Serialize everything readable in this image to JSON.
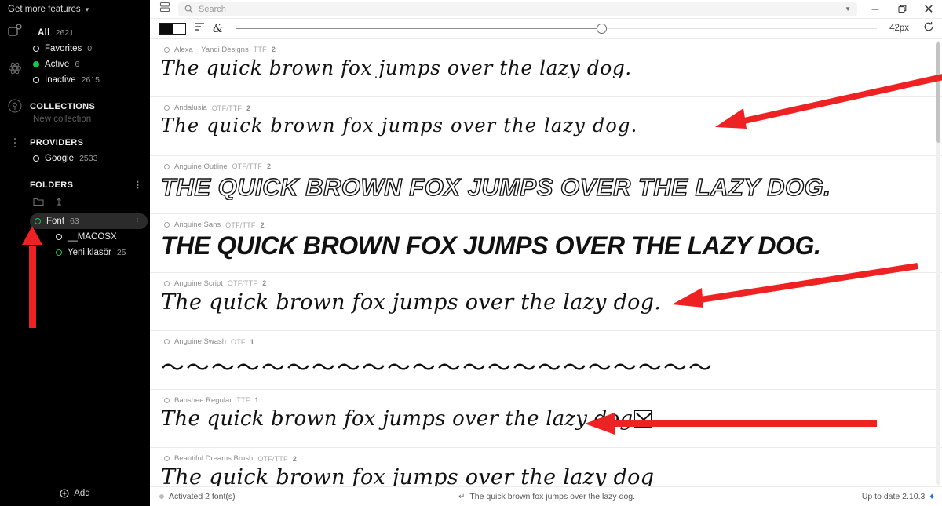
{
  "sidebar": {
    "header": {
      "label": "Get more features",
      "chevron": "chevron-down-icon"
    },
    "rail_icons": [
      "fonts-icon",
      "settings-atom-icon",
      "broadcast-icon",
      "more-vertical-icon"
    ],
    "filters": [
      {
        "label": "All",
        "count": "2621",
        "state": "none"
      },
      {
        "label": "Favorites",
        "count": "0",
        "state": "ring"
      },
      {
        "label": "Active",
        "count": "6",
        "state": "green"
      },
      {
        "label": "Inactive",
        "count": "2615",
        "state": "ring"
      }
    ],
    "collections": {
      "title": "COLLECTIONS",
      "new_label": "New collection"
    },
    "providers": {
      "title": "PROVIDERS",
      "items": [
        {
          "label": "Google",
          "count": "2533",
          "state": "ring"
        }
      ]
    },
    "folders": {
      "title": "FOLDERS",
      "kebab": "more-options-icon",
      "actions": [
        "new-folder-icon",
        "import-folder-icon"
      ],
      "items": [
        {
          "label": "Font",
          "count": "63",
          "state": "hollow-green",
          "selected": true,
          "kebab": "more-options-icon"
        },
        {
          "label": "__MACOSX",
          "count": "",
          "state": "ring",
          "selected": false
        },
        {
          "label": "Yeni klasör",
          "count": "25",
          "state": "hollow-green",
          "selected": false
        }
      ]
    },
    "add_button": {
      "label": "Add",
      "icon": "plus-circle-icon"
    }
  },
  "titlebar": {
    "panel_toggle_icon": "panel-layout-icon",
    "search": {
      "placeholder": "Search",
      "value": "",
      "icon": "search-icon",
      "caret": "chevron-down-icon"
    },
    "window_controls": [
      {
        "name": "minimize-button",
        "glyph": "–"
      },
      {
        "name": "maximize-button",
        "glyph": "❐"
      },
      {
        "name": "close-button",
        "glyph": "✕"
      }
    ]
  },
  "toolbar": {
    "contrast_toggle": "black-white-contrast-toggle",
    "align_icon": "text-align-left-icon",
    "glyph_icon": "ampersand-glyph-icon",
    "slider": {
      "value_percent": 57
    },
    "size_label": "42px",
    "reset_icon": "reset-rotate-icon"
  },
  "fonts": [
    {
      "name": "Alexa _ Yandi Designs",
      "format": "TTF",
      "styles": "2",
      "preview": "The quick brown fox jumps over the lazy dog.",
      "style_class": "p-script"
    },
    {
      "name": "Andalusia",
      "format": "OTF/TTF",
      "styles": "2",
      "preview": "The quick brown fox jumps over the lazy dog.",
      "style_class": "p-thin-script"
    },
    {
      "name": "Anguine Outline",
      "format": "OTF/TTF",
      "styles": "2",
      "preview": "THE QUICK BROWN FOX JUMPS OVER THE LAZY  DOG.",
      "style_class": "p-outline"
    },
    {
      "name": "Anguine Sans",
      "format": "OTF/TTF",
      "styles": "2",
      "preview": "THE QUICK BROWN FOX JUMPS OVER THE LAZY DOG.",
      "style_class": "p-sans-black"
    },
    {
      "name": "Anguine Script",
      "format": "OTF/TTF",
      "styles": "2",
      "preview": "The quick brown fox jumps over the lazy dog.",
      "style_class": "p-brush"
    },
    {
      "name": "Anguine Swash",
      "format": "OTF",
      "styles": "1",
      "preview": "〜〜〜〜〜〜〜〜〜〜〜〜〜〜〜〜〜〜〜〜〜〜",
      "style_class": "p-swash"
    },
    {
      "name": "Banshee Regular",
      "format": "TTF",
      "styles": "1",
      "preview": "The quick brown fox jumps over the lazy dog",
      "style_class": "p-handwrite",
      "missing_glyph": true
    },
    {
      "name": "Beautiful Dreams Brush",
      "format": "OTF/TTF",
      "styles": "2",
      "preview": "The quick brown fox jumps over the lazy dog",
      "style_class": "p-brush"
    }
  ],
  "status": {
    "left": "Activated 2 font(s)",
    "center_icon": "enter-key-icon",
    "center": "The quick brown fox jumps over the lazy dog.",
    "right": "Up to date 2.10.3",
    "right_icon": "app-logo-icon"
  },
  "annotations": {
    "color": "#ee2222",
    "arrows": [
      {
        "name": "annotation-arrow-to-andalusia-row"
      },
      {
        "name": "annotation-arrow-to-anguine-script-row"
      },
      {
        "name": "annotation-arrow-to-banshee-row"
      },
      {
        "name": "annotation-arrow-to-font-folder"
      }
    ]
  }
}
